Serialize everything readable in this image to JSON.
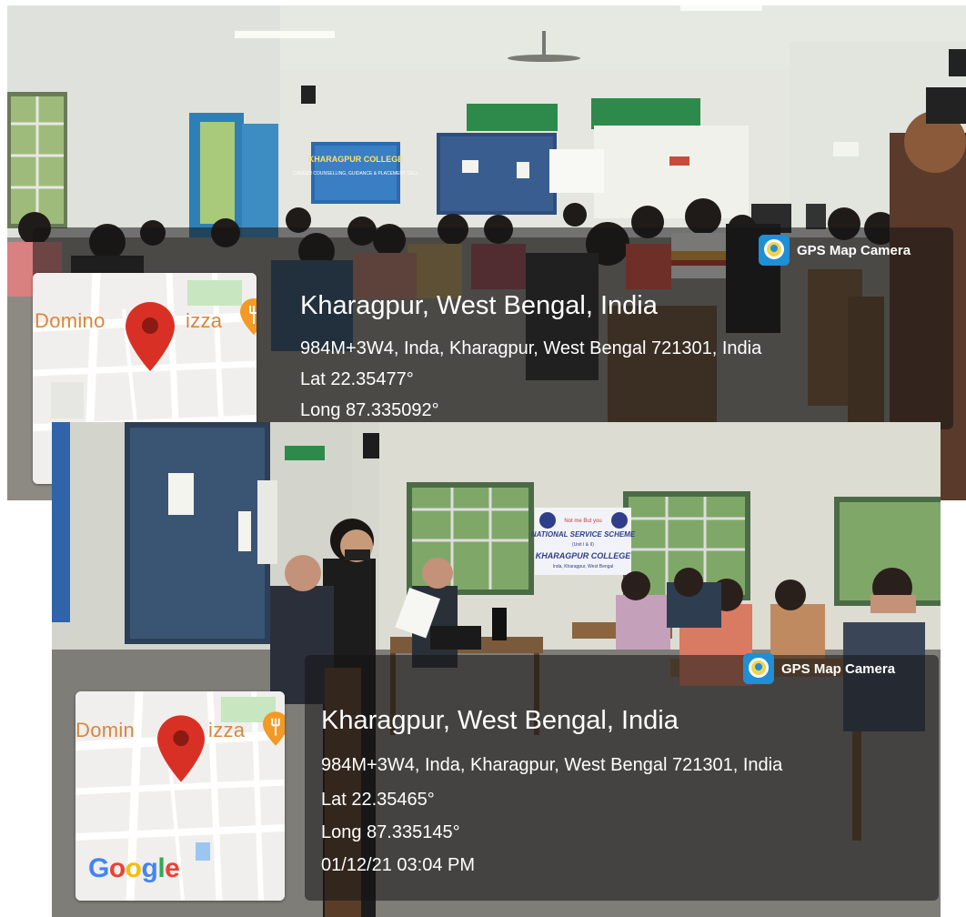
{
  "photos": [
    {
      "badge": "GPS Map Camera",
      "place": "Kharagpur, West Bengal, India",
      "address": "984M+3W4, Inda, Kharagpur, West Bengal 721301, India",
      "lat": "Lat 22.35477°",
      "long": "Long 87.335092°",
      "map": {
        "label_left": "Domino",
        "label_right": "izza",
        "pin_icon": "map-pin-icon",
        "poi_icon": "restaurant-icon"
      },
      "signs": {
        "college_banner_title": "KHARAGPUR COLLEGE",
        "college_banner_subtitle": "CAREER COUNSELLING, GUIDANCE & PLACEMENT CELL"
      }
    },
    {
      "badge": "GPS Map Camera",
      "place": "Kharagpur, West Bengal, India",
      "address": "984M+3W4, Inda, Kharagpur, West Bengal 721301, India",
      "lat": "Lat 22.35465°",
      "long": "Long 87.335145°",
      "datetime": "01/12/21 03:04 PM",
      "map": {
        "label_left": "Domin",
        "label_right": "izza",
        "pin_icon": "map-pin-icon",
        "poi_icon": "restaurant-icon",
        "logo": "Google"
      },
      "signs": {
        "nss_top": "Not me But you",
        "nss_title": "NATIONAL SERVICE SCHEME",
        "nss_unit": "(Unit I & II)",
        "nss_college": "KHARAGPUR COLLEGE",
        "nss_place": "Inda, Kharagpur, West Bengal"
      }
    }
  ],
  "colors": {
    "overlay": "#141414",
    "pin": "#d93025",
    "badge_icon": "#1f8fd6",
    "google_blue": "#4285f4",
    "google_red": "#ea4335",
    "google_yellow": "#fbbc05",
    "google_green": "#34a853"
  }
}
